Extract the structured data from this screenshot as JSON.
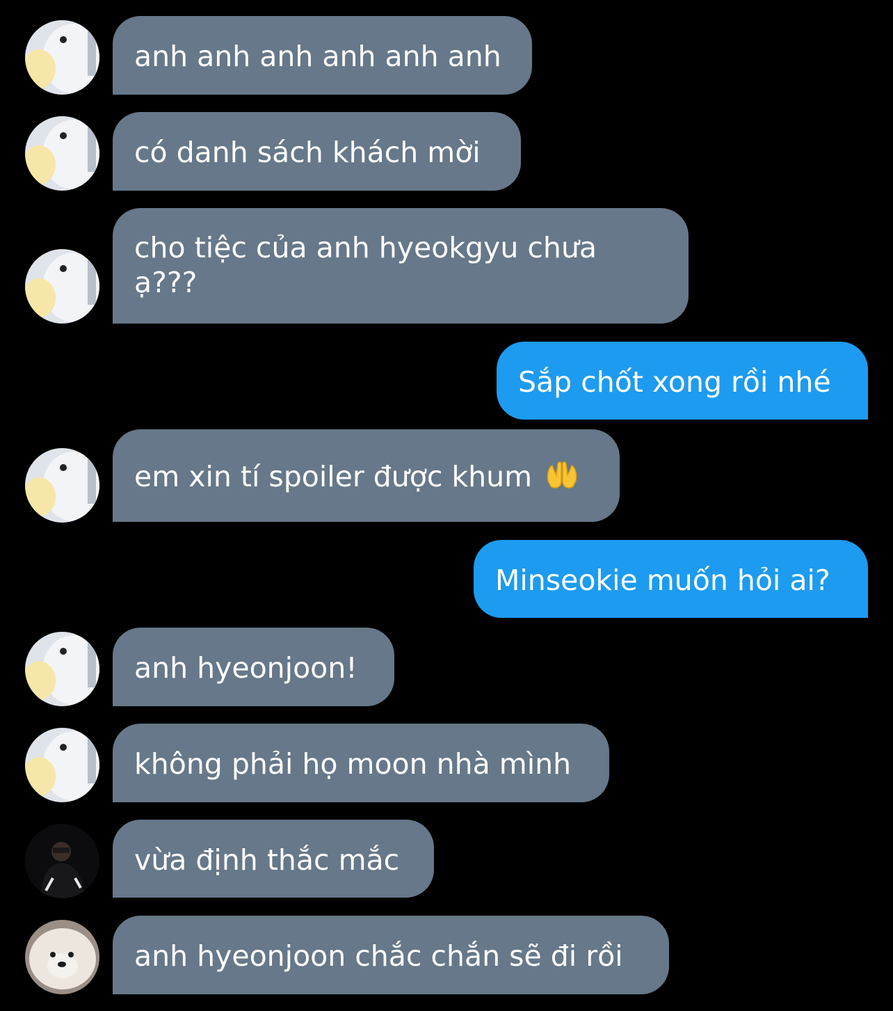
{
  "conversation": {
    "messages": [
      {
        "sender": "incoming",
        "avatar": "plush-duck-avatar",
        "text": "anh anh anh anh anh anh"
      },
      {
        "sender": "incoming",
        "avatar": "plush-duck-avatar",
        "text": "có danh sách khách mời"
      },
      {
        "sender": "incoming",
        "avatar": "plush-duck-avatar",
        "text": "cho tiệc của anh hyeokgyu chưa ạ???"
      },
      {
        "sender": "outgoing",
        "text": "Sắp chốt xong rồi nhé"
      },
      {
        "sender": "incoming",
        "avatar": "plush-duck-avatar",
        "text": "em xin tí spoiler được khum",
        "emoji": "raised-hands-icon"
      },
      {
        "sender": "outgoing",
        "text": "Minseokie muốn hỏi ai?"
      },
      {
        "sender": "incoming",
        "avatar": "plush-duck-avatar",
        "text": "anh hyeonjoon!"
      },
      {
        "sender": "incoming",
        "avatar": "plush-duck-avatar",
        "text": "không phải họ moon nhà mình"
      },
      {
        "sender": "incoming",
        "avatar": "person-dark-avatar",
        "text": "vừa định thắc mắc"
      },
      {
        "sender": "incoming",
        "avatar": "fluffy-dog-avatar",
        "text": "anh hyeonjoon chắc chắn sẽ đi rồi"
      }
    ]
  },
  "colors": {
    "background": "#000000",
    "incoming_bubble": "#667889",
    "outgoing_bubble": "#1d9bf0",
    "text": "#ffffff"
  }
}
